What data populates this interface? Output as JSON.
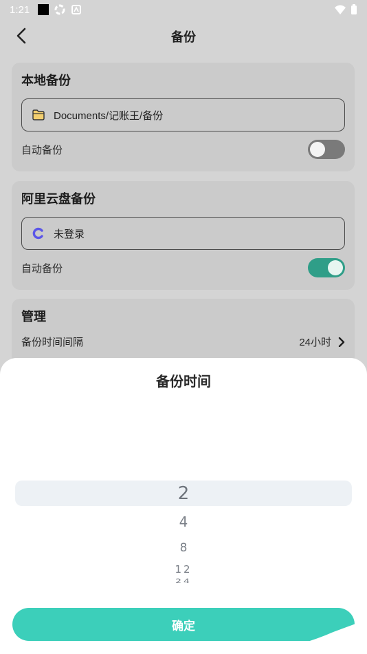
{
  "status_bar": {
    "time": "1:21"
  },
  "app_bar": {
    "title": "备份"
  },
  "local_backup": {
    "title": "本地备份",
    "path": "Documents/记账王/备份",
    "auto_label": "自动备份",
    "auto_enabled": false
  },
  "aliyun_backup": {
    "title": "阿里云盘备份",
    "account": "未登录",
    "auto_label": "自动备份",
    "auto_enabled": true
  },
  "manage": {
    "title": "管理",
    "interval_label": "备份时间间隔",
    "interval_value": "24小时"
  },
  "sheet": {
    "title": "备份时间",
    "options": [
      "2",
      "4",
      "8",
      "12",
      "24"
    ],
    "selected": "2",
    "confirm_label": "确定"
  },
  "colors": {
    "accent": "#3ccfba",
    "toggle_on": "#2f9e88",
    "toggle_off": "#7a7a7a"
  }
}
